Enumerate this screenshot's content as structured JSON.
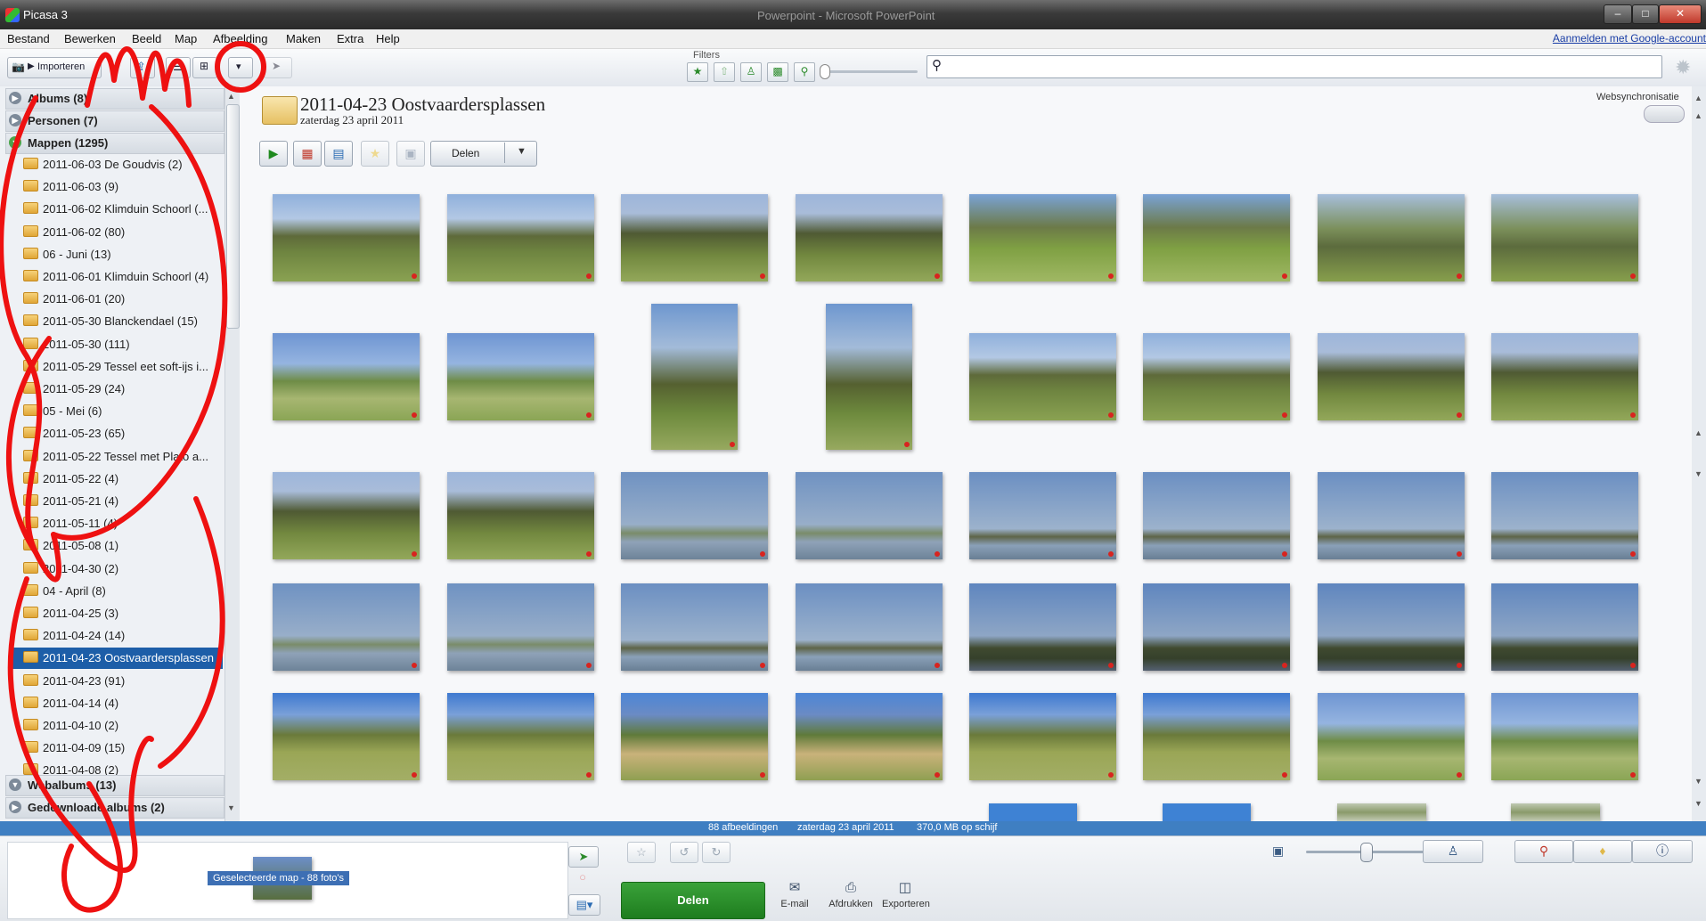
{
  "window": {
    "title": "Picasa 3",
    "background_title": "Powerpoint - Microsoft PowerPoint"
  },
  "menu": [
    "Bestand",
    "Bewerken",
    "Beeld",
    "Map",
    "Afbeelding",
    "Maken",
    "Extra",
    "Help"
  ],
  "signin_link": "Aanmelden met Google-account",
  "toolbar": {
    "import_label": "Importeren",
    "filters_label": "Filters",
    "search_value": "",
    "filter_icons": [
      "star-icon",
      "upload-icon",
      "person-icon",
      "video-icon",
      "pin-icon"
    ]
  },
  "sidebar": {
    "sections": [
      {
        "label": "Albums (8)",
        "state": "collapsed"
      },
      {
        "label": "Personen (7)",
        "state": "collapsed"
      },
      {
        "label": "Mappen (1295)",
        "state": "expanded"
      },
      {
        "label": "Webalbums (13)",
        "state": "collapsed"
      },
      {
        "label": "Gedownloade albums (2)",
        "state": "collapsed"
      }
    ],
    "folders": [
      "2011-06-03 De Goudvis (2)",
      "2011-06-03 (9)",
      "2011-06-02 Klimduin Schoorl (...",
      "2011-06-02 (80)",
      "06 - Juni (13)",
      "2011-06-01 Klimduin Schoorl (4)",
      "2011-06-01 (20)",
      "2011-05-30 Blanckendael (15)",
      "2011-05-30 (111)",
      "2011-05-29 Tessel eet soft-ijs i...",
      "2011-05-29 (24)",
      "05 - Mei (6)",
      "2011-05-23 (65)",
      "2011-05-22 Tessel met Plato a...",
      "2011-05-22 (4)",
      "2011-05-21 (4)",
      "2011-05-11 (4)",
      "2011-05-08 (1)",
      "2011-04-30 (2)",
      "04 - April (8)",
      "2011-04-25 (3)",
      "2011-04-24 (14)",
      "2011-04-23 Oostvaardersplassen",
      "2011-04-23 (91)",
      "2011-04-14 (4)",
      "2011-04-10 (2)",
      "2011-04-09 (15)",
      "2011-04-08 (2)"
    ],
    "selected_folder": "2011-04-23 Oostvaardersplassen"
  },
  "folder_header": {
    "title": "2011-04-23 Oostvaardersplassen",
    "date": "zaterdag 23 april 2011",
    "websync_label": "Websynchronisatie",
    "share_label": "Delen"
  },
  "thumbnails": [
    [
      "forest",
      "forest",
      "forest2",
      "forest2",
      "grass",
      "grass",
      "person",
      "person"
    ],
    [
      "path",
      "path",
      "portrait",
      "portrait",
      "forest",
      "forest",
      "forest2",
      "forest2"
    ],
    [
      "forest2",
      "forest2",
      "lake",
      "lake",
      "lake2",
      "lake2",
      "lake2",
      "lake2"
    ],
    [
      "lake",
      "lake",
      "lake2",
      "lake2",
      "marsh",
      "marsh",
      "marsh",
      "marsh"
    ],
    [
      "field",
      "field",
      "field2",
      "field2",
      "field",
      "field",
      "path",
      "path"
    ],
    [
      "empty",
      "empty",
      "empty",
      "empty",
      "blue",
      "blue",
      "aerial",
      "aerial"
    ]
  ],
  "status": {
    "count": "88 afbeeldingen",
    "date": "zaterdag 23 april 2011",
    "size": "370,0 MB op schijf"
  },
  "tray": {
    "caption": "Geselecteerde map - 88 foto's",
    "share_label": "Delen",
    "actions": [
      {
        "label": "E-mail",
        "icon": "envelope-icon"
      },
      {
        "label": "Afdrukken",
        "icon": "printer-icon"
      },
      {
        "label": "Exporteren",
        "icon": "export-icon"
      }
    ]
  }
}
